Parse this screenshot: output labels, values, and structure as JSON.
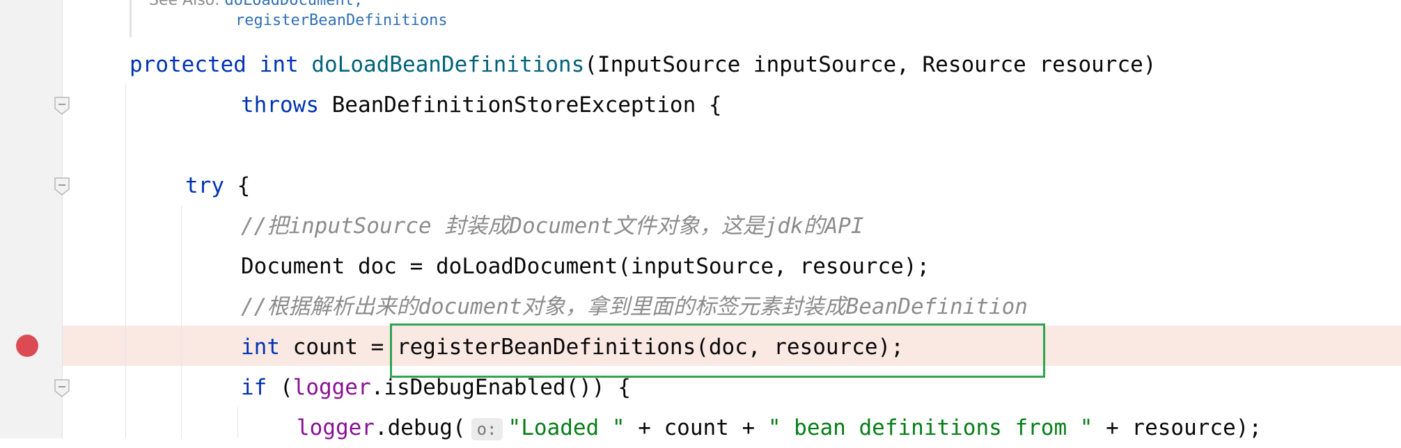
{
  "doc": {
    "see_also_label": "See Also:",
    "see_also_link": "doLoadDocument,",
    "see_also_link2": "registerBeanDefinitions"
  },
  "code": {
    "l1_kw1": "protected",
    "l1_kw2": "int",
    "l1_fn": "doLoadBeanDefinitions",
    "l1_rest": "(InputSource inputSource, Resource resource)",
    "l2_kw": "throws",
    "l2_rest": " BeanDefinitionStoreException {",
    "l3_kw": "try",
    "l3_rest": " {",
    "l4_comment": "//把inputSource 封装成Document文件对象，这是jdk的API",
    "l5_text": "Document doc = doLoadDocument(inputSource, resource);",
    "l6_comment": "//根据解析出来的document对象，拿到里面的标签元素封装成BeanDefinition",
    "l7_kw": "int",
    "l7_rest": " count = registerBeanDefinitions(doc, resource);",
    "l8_kw": "if",
    "l8_p1": " (",
    "l8_field": "logger",
    "l8_rest": ".isDebugEnabled()) {",
    "l9_field": "logger",
    "l9_p1": ".debug(",
    "l9_hint": "o:",
    "l9_str1": "\"Loaded \"",
    "l9_p2": " + count + ",
    "l9_str2": "\" bean definitions from \"",
    "l9_p3": " + resource);"
  },
  "colors": {
    "keyword": "#0033b3",
    "method": "#00627a",
    "field": "#871094",
    "string": "#067d17",
    "comment": "#8c8c8c",
    "breakpoint": "#dc4a54",
    "highlight_box": "#2ea44f"
  },
  "gutter": {
    "breakpoint_icon": "breakpoint-dot",
    "fold_icon": "fold-marker"
  }
}
